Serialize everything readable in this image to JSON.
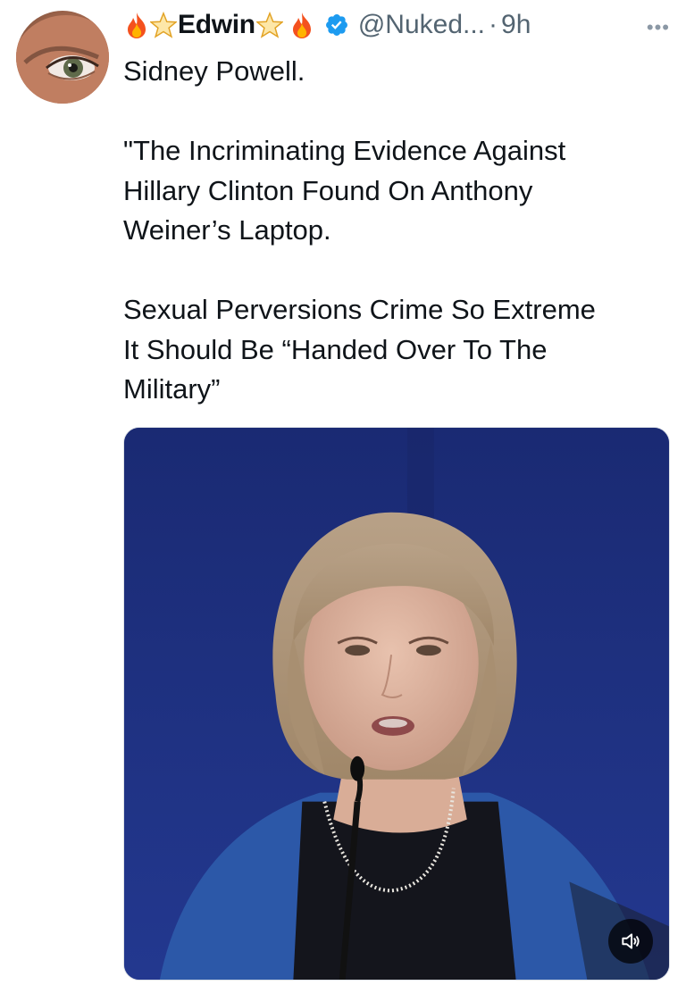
{
  "author": {
    "display_name": "Edwin",
    "handle": "@Nuked...",
    "separator": "·",
    "time": "9h",
    "verified": true,
    "name_emoji_left": [
      "fire-emoji",
      "star-emoji"
    ],
    "name_emoji_right": [
      "star-emoji",
      "fire-emoji"
    ]
  },
  "tweet": {
    "paragraphs": [
      [
        "Sidney Powell."
      ],
      [
        "\"The Incriminating Evidence Against",
        "Hillary Clinton Found On Anthony",
        "Weiner’s Laptop."
      ],
      [
        "Sexual Perversions Crime So Extreme",
        "It Should Be “Handed Over To The",
        "Military”"
      ]
    ]
  },
  "media": {
    "type": "video",
    "icons": {
      "more": "more-options-icon",
      "mute": "speaker-muted-icon",
      "verified": "verified-badge-icon"
    }
  },
  "colors": {
    "text": "#0f1419",
    "secondary": "#536471",
    "verified": "#1d9bf0",
    "video_background": "#1c2f7f"
  }
}
